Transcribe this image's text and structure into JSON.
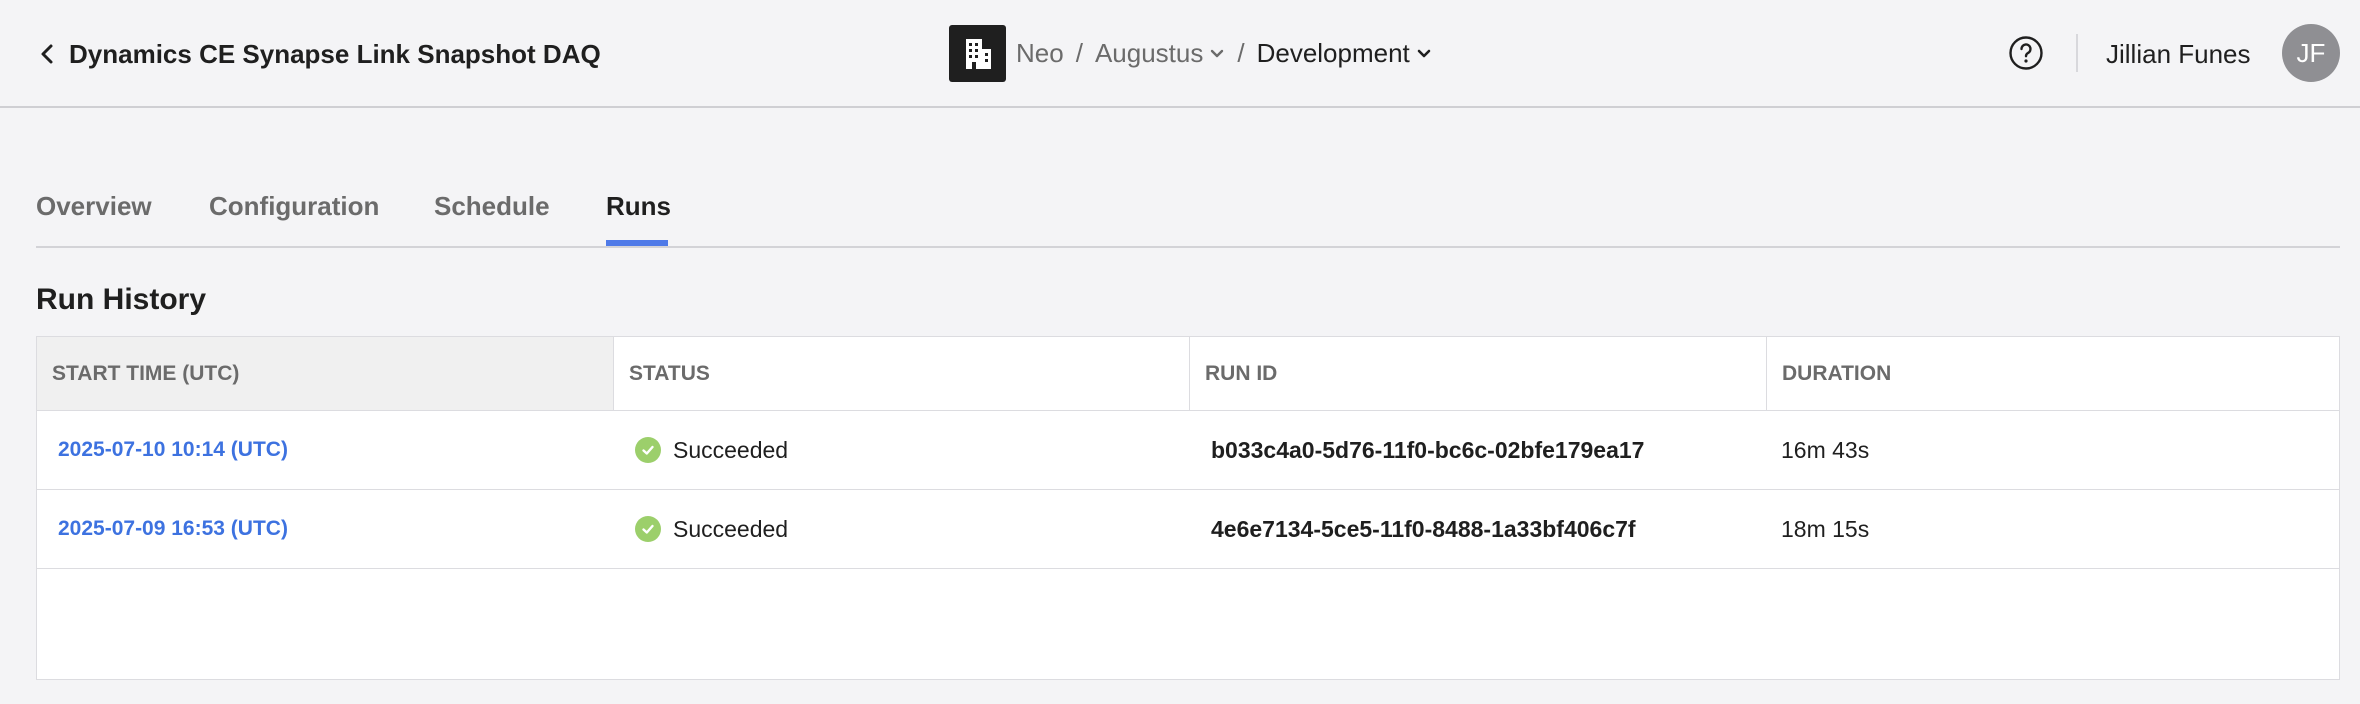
{
  "header": {
    "title": "Dynamics CE Synapse Link Snapshot DAQ",
    "breadcrumbs": [
      {
        "label": "Neo"
      },
      {
        "label": "Augustus"
      },
      {
        "label": "Development"
      }
    ],
    "separator": "/",
    "user_name": "Jillian Funes",
    "avatar_initials": "JF"
  },
  "tabs": [
    {
      "label": "Overview"
    },
    {
      "label": "Configuration"
    },
    {
      "label": "Schedule"
    },
    {
      "label": "Runs",
      "active": true
    }
  ],
  "section": {
    "title": "Run History"
  },
  "table": {
    "columns": [
      "START TIME (UTC)",
      "STATUS",
      "RUN ID",
      "DURATION"
    ],
    "rows": [
      {
        "start_time": "2025-07-10 10:14 (UTC)",
        "status": "Succeeded",
        "run_id": "b033c4a0-5d76-11f0-bc6c-02bfe179ea17",
        "duration": "16m 43s"
      },
      {
        "start_time": "2025-07-09 16:53 (UTC)",
        "status": "Succeeded",
        "run_id": "4e6e7134-5ce5-11f0-8488-1a33bf406c7f",
        "duration": "18m 15s"
      }
    ]
  },
  "colors": {
    "accent": "#4f7ae8",
    "link": "#3d72e0",
    "success": "#9ccf6b"
  }
}
